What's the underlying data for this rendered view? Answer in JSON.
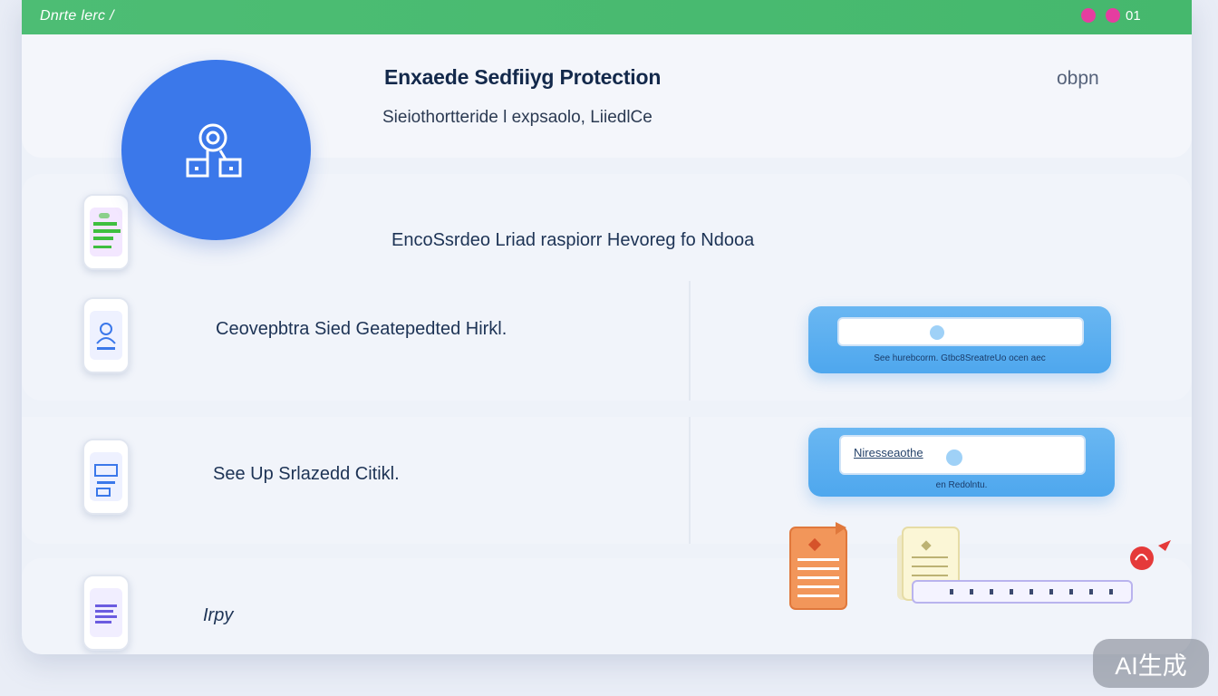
{
  "window": {
    "title": "Dnrte lerc /",
    "counter": "01"
  },
  "header": {
    "title": "Enxaede Sedfiiyg Protection",
    "subtitle": "Sieiothortteride l expsaolo, LiiedlCe",
    "action_label": "obpn"
  },
  "section1": {
    "heading": "EncoSsrdeo Lriad raspiorr Hevoreg fo Ndooa",
    "row_label": "Ceovepbtra Sied Geatepedted Hirkl.",
    "panel_input_value": "",
    "panel_caption": "See hurebcorm. Gtbc8SreatreUo ocen aec"
  },
  "section2": {
    "row_label": "See Up Srlazedd Citikl.",
    "panel_input_value": "Niresseaothe",
    "panel_caption": "en Redolntu."
  },
  "section3": {
    "row_label": "Irpy"
  },
  "watermark": "AI生成",
  "colors": {
    "titlebar": "#4dbd74",
    "accent_blue": "#3b78ea",
    "panel_blue": "#5aaef0",
    "alert_red": "#e53a3a",
    "doc_orange": "#f2965a"
  },
  "icons": [
    "lock-person-icon",
    "phone-list-icon",
    "phone-user-icon",
    "phone-id-icon",
    "phone-doc-icon",
    "document-icon",
    "alert-badge-icon"
  ]
}
